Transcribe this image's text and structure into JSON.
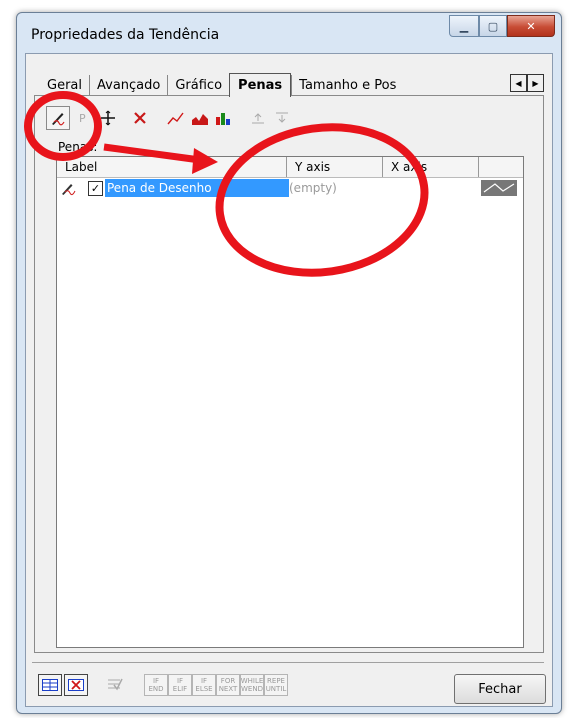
{
  "window": {
    "title": "Propriedades da Tendência"
  },
  "tabs": [
    "Geral",
    "Avançado",
    "Gráfico",
    "Penas",
    "Tamanho e Pos"
  ],
  "active_tab": "Penas",
  "pens_label": "Penas:",
  "list": {
    "columns": [
      "Label",
      "Y axis",
      "X axis"
    ],
    "rows": [
      {
        "checked": true,
        "label": "Pena de Desenho",
        "y_axis": "(empty)",
        "x_axis": ""
      }
    ]
  },
  "bottom": {
    "script_buttons": [
      [
        "IF",
        "END"
      ],
      [
        "IF",
        "ELIF"
      ],
      [
        "IF",
        "ELSE"
      ],
      [
        "FOR",
        "NEXT"
      ],
      [
        "WHILE",
        "WEND"
      ],
      [
        "REPE",
        "UNTIL"
      ]
    ],
    "close_label": "Fechar"
  },
  "colors": {
    "annotation": "#e8141b",
    "selection": "#3399ff"
  }
}
